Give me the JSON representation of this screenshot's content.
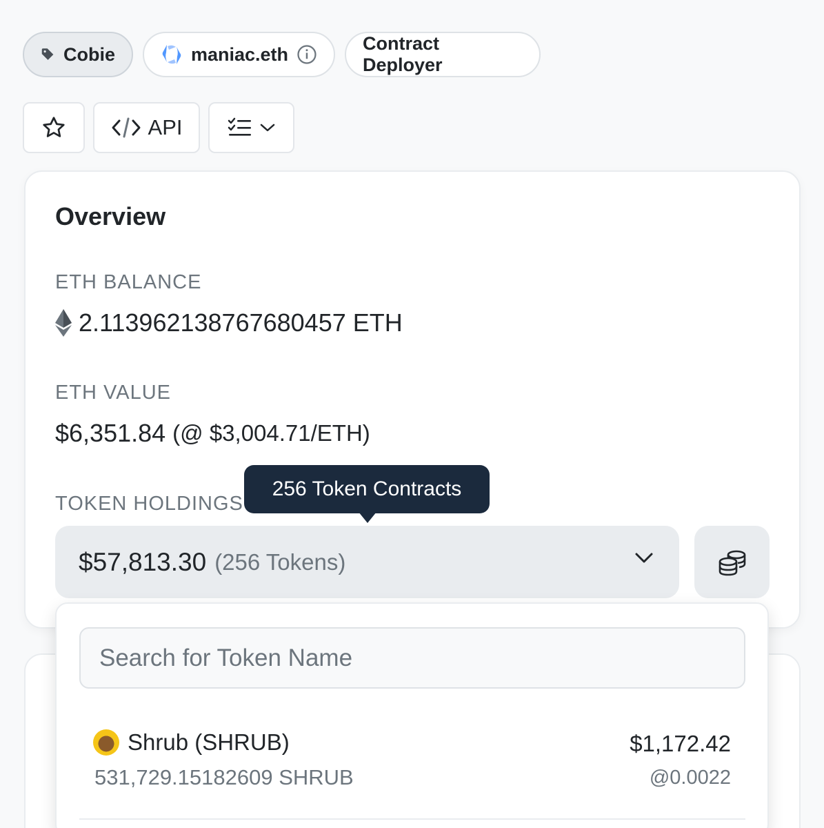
{
  "tags": {
    "name_tag": "Cobie",
    "ens_name": "maniac.eth",
    "role_tag": "Contract Deployer"
  },
  "actions": {
    "api_label": "API"
  },
  "overview": {
    "title": "Overview",
    "eth_balance_label": "ETH BALANCE",
    "eth_balance_value": "2.113962138767680457 ETH",
    "eth_value_label": "ETH VALUE",
    "eth_value_amount": "$6,351.84",
    "eth_value_rate": "(@ $3,004.71/ETH)",
    "token_holdings_label": "TOKEN HOLDINGS",
    "token_holdings_amount": "$57,813.30",
    "token_holdings_count": "(256 Tokens)",
    "tooltip": "256 Token Contracts"
  },
  "dropdown": {
    "search_placeholder": "Search for Token Name",
    "tokens": [
      {
        "name": "Shrub (SHRUB)",
        "quantity": "531,729.15182609 SHRUB",
        "value": "$1,172.42",
        "price": "@0.0022"
      }
    ]
  },
  "colors": {
    "tooltip_bg": "#1b2a3d",
    "ens_blue": "#5298ff",
    "selector_bg": "#e9ecef"
  }
}
